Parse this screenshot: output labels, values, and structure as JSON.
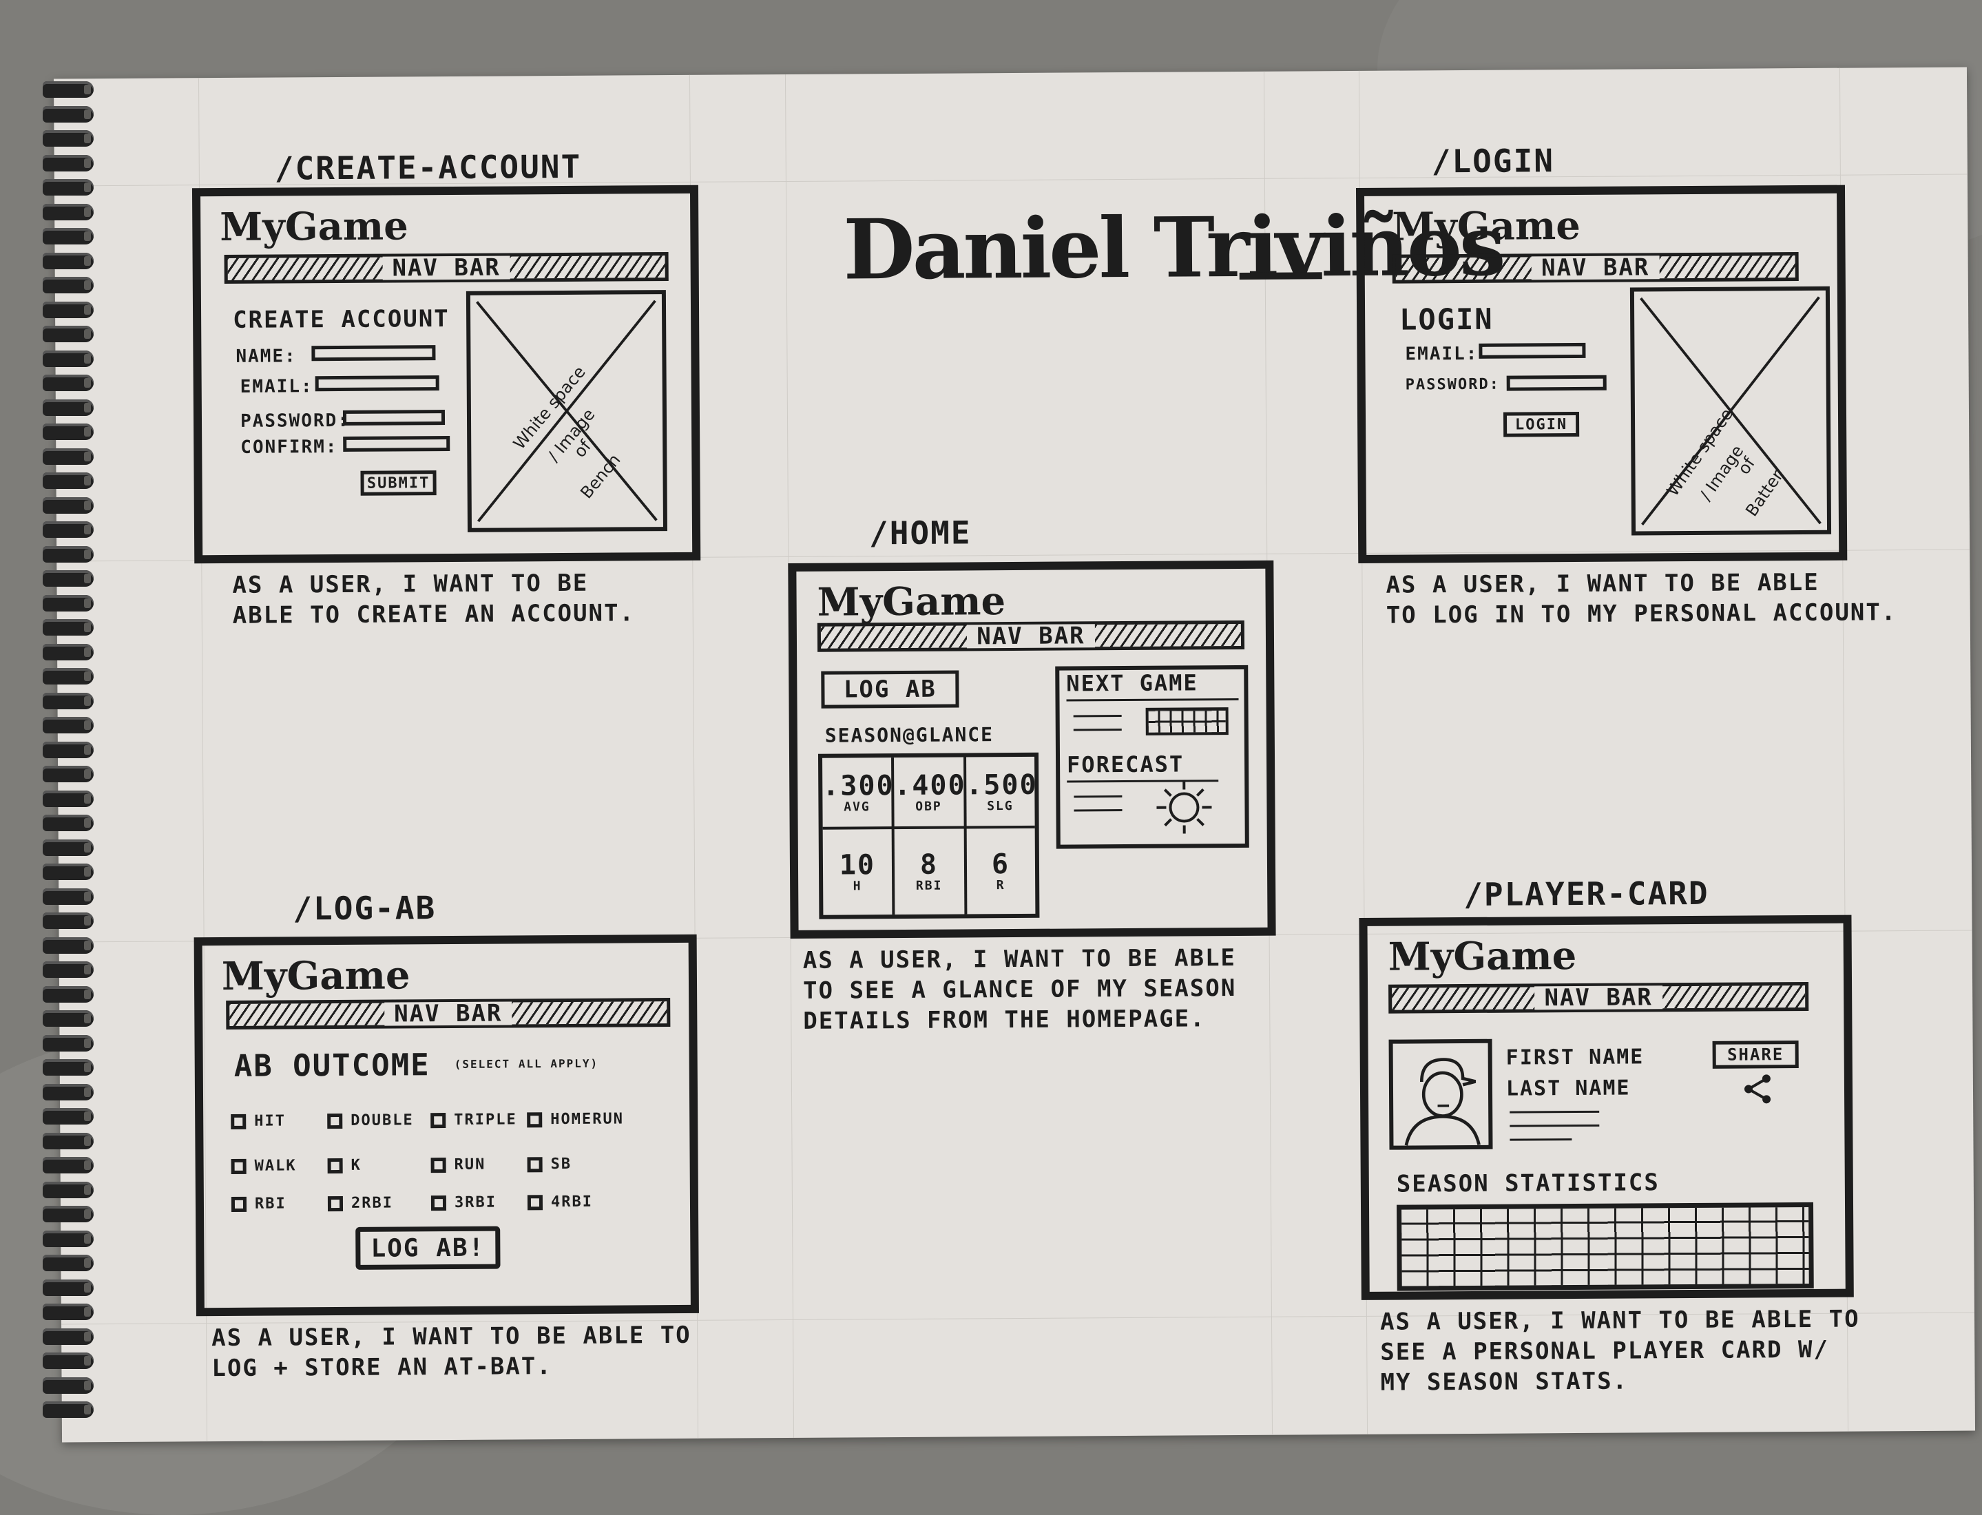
{
  "author_title": "Daniel Triviños",
  "nav_label": "Nav Bar",
  "brand": "MyGame",
  "create_account": {
    "route": "/create-account",
    "heading": "Create Account",
    "fields": [
      "Name:",
      "Email:",
      "Password:",
      "Confirm:"
    ],
    "submit": "Submit",
    "image_text": [
      "White space",
      "/ Image",
      "of",
      "Bench"
    ],
    "story": [
      "As a user, I want to be",
      "able to create an account."
    ]
  },
  "login": {
    "route": "/login",
    "heading": "Login",
    "fields": [
      "Email:",
      "Password:"
    ],
    "button": "Login",
    "image_text": [
      "White space",
      "/ Image",
      "of",
      "Batter"
    ],
    "story": [
      "As a user, I want to be able",
      "to log in to my personal account."
    ]
  },
  "home": {
    "route": "/home",
    "log_ab": "Log AB",
    "season_heading": "Season@Glance",
    "stats": [
      {
        "value": ".300",
        "label": "AVG"
      },
      {
        "value": ".400",
        "label": "OBP"
      },
      {
        "value": ".500",
        "label": "SLG"
      },
      {
        "value": "10",
        "label": "H"
      },
      {
        "value": "8",
        "label": "RBI"
      },
      {
        "value": "6",
        "label": "R"
      }
    ],
    "next_game": "Next Game",
    "forecast": "Forecast",
    "story": [
      "As a user, I want to be able",
      "to see a glance of my season",
      "details from the homepage."
    ]
  },
  "log_ab": {
    "route": "/log-AB",
    "heading": "AB Outcome",
    "subheading": "(select all apply)",
    "options": [
      "Hit",
      "Double",
      "Triple",
      "Homerun",
      "Walk",
      "K",
      "Run",
      "SB",
      "RBI",
      "2RBI",
      "3RBI",
      "4RBI"
    ],
    "button": "Log AB!",
    "story": [
      "As a user, I want to be able to",
      "log + store an at-bat."
    ]
  },
  "player_card": {
    "route": "/player-card",
    "first_name": "First Name",
    "last_name": "Last Name",
    "share": "Share",
    "season_heading": "Season Statistics",
    "story": [
      "As a user, I want to be able to",
      "see a personal player card w/",
      "my season stats."
    ]
  },
  "colors": {
    "ink": "#1d1d1d",
    "paper": "#e4e1dd",
    "background": "#7e7d79"
  }
}
